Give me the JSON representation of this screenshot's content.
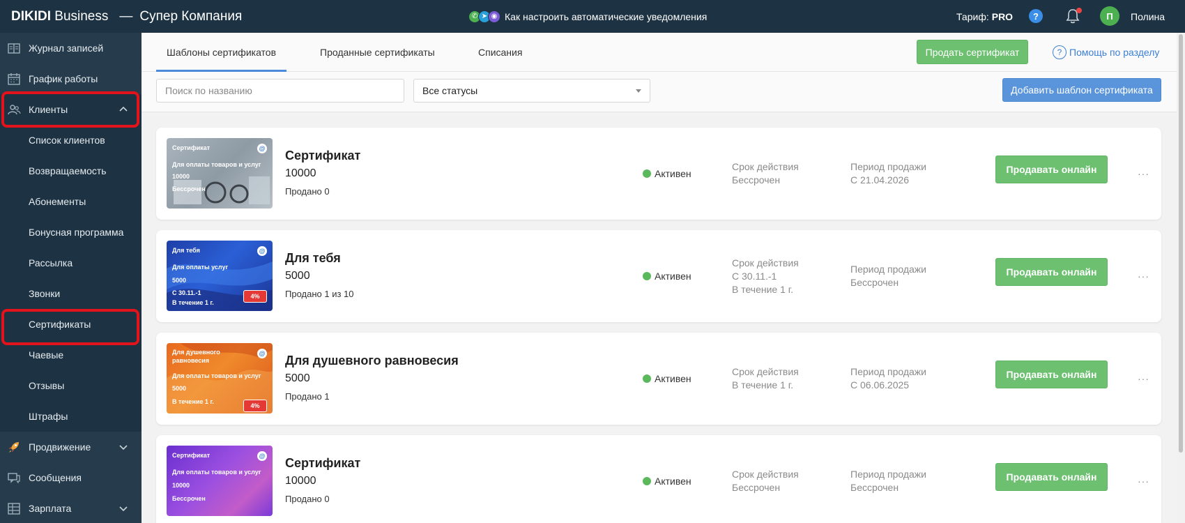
{
  "topbar": {
    "brand_bold": "DIKIDI",
    "brand_rest": " Business",
    "separator": "—",
    "company": "Супер Компания",
    "promo_text": "Как настроить автоматические уведомления",
    "tariff_label": "Тариф:",
    "tariff_value": "PRO",
    "help_glyph": "?",
    "avatar_letter": "П",
    "username": "Полина"
  },
  "sidebar": {
    "items": [
      {
        "label": "Журнал записей",
        "icon": "journal-icon"
      },
      {
        "label": "График работы",
        "icon": "calendar-icon"
      },
      {
        "label": "Клиенты",
        "icon": "clients-icon"
      },
      {
        "label": "Список клиентов"
      },
      {
        "label": "Возвращаемость"
      },
      {
        "label": "Абонементы"
      },
      {
        "label": "Бонусная программа"
      },
      {
        "label": "Рассылка"
      },
      {
        "label": "Звонки"
      },
      {
        "label": "Сертификаты"
      },
      {
        "label": "Чаевые"
      },
      {
        "label": "Отзывы"
      },
      {
        "label": "Штрафы"
      },
      {
        "label": "Продвижение",
        "icon": "rocket-icon"
      },
      {
        "label": "Сообщения",
        "icon": "messages-icon"
      },
      {
        "label": "Зарплата",
        "icon": "salary-icon"
      }
    ]
  },
  "tabs": [
    {
      "label": "Шаблоны сертификатов",
      "active": true
    },
    {
      "label": "Проданные сертификаты",
      "active": false
    },
    {
      "label": "Списания",
      "active": false
    }
  ],
  "actions": {
    "sell_certificate": "Продать сертификат",
    "help_section": "Помощь по разделу",
    "add_template": "Добавить шаблон сертификата"
  },
  "filters": {
    "search_placeholder": "Поиск по названию",
    "status_selected": "Все статусы"
  },
  "cards": [
    {
      "thumb": {
        "l1": "Сертификат",
        "l2": "Для оплаты товаров и услуг",
        "l3": "10000",
        "l4": "Бессрочен",
        "l5": "",
        "badge": ""
      },
      "title": "Сертификат",
      "price": "10000",
      "sold": "Продано 0",
      "status": "Активен",
      "validity_label": "Срок действия",
      "validity_1": "Бессрочен",
      "validity_2": "",
      "period_label": "Период продажи",
      "period_value": "С 21.04.2026",
      "sell_button": "Продавать онлайн",
      "more": "···"
    },
    {
      "thumb": {
        "l1": "Для тебя",
        "l2": "Для оплаты услуг",
        "l3": "5000",
        "l4": "С 30.11.-1",
        "l5": "В течение 1 г.",
        "badge": "4%"
      },
      "title": "Для тебя",
      "price": "5000",
      "sold": "Продано 1 из 10",
      "status": "Активен",
      "validity_label": "Срок действия",
      "validity_1": "С 30.11.-1",
      "validity_2": "В течение 1 г.",
      "period_label": "Период продажи",
      "period_value": "Бессрочен",
      "sell_button": "Продавать онлайн",
      "more": "···"
    },
    {
      "thumb": {
        "l1": "Для душевного",
        "l1b": "равновесия",
        "l2": "Для оплаты товаров и услуг",
        "l3": "5000",
        "l4": "В течение 1 г.",
        "l5": "",
        "badge": "4%"
      },
      "title": "Для душевного равновесия",
      "price": "5000",
      "sold": "Продано 1",
      "status": "Активен",
      "validity_label": "Срок действия",
      "validity_1": "В течение 1 г.",
      "validity_2": "",
      "period_label": "Период продажи",
      "period_value": "С 06.06.2025",
      "sell_button": "Продавать онлайн",
      "more": "···"
    },
    {
      "thumb": {
        "l1": "Сертификат",
        "l2": "Для оплаты товаров и услуг",
        "l3": "10000",
        "l4": "Бессрочен",
        "l5": "",
        "badge": ""
      },
      "title": "Сертификат",
      "price": "10000",
      "sold": "Продано 0",
      "status": "Активен",
      "validity_label": "Срок действия",
      "validity_1": "Бессрочен",
      "validity_2": "",
      "period_label": "Период продажи",
      "period_value": "Бессрочен",
      "sell_button": "Продавать онлайн",
      "more": "···"
    }
  ],
  "colors": {
    "topbar_bg": "#1d3242",
    "sidebar_bg": "#263c4c",
    "accent_green": "#6cc070",
    "accent_blue": "#5a95db",
    "highlight_red": "#e3131b",
    "status_green": "#5cb85c"
  }
}
